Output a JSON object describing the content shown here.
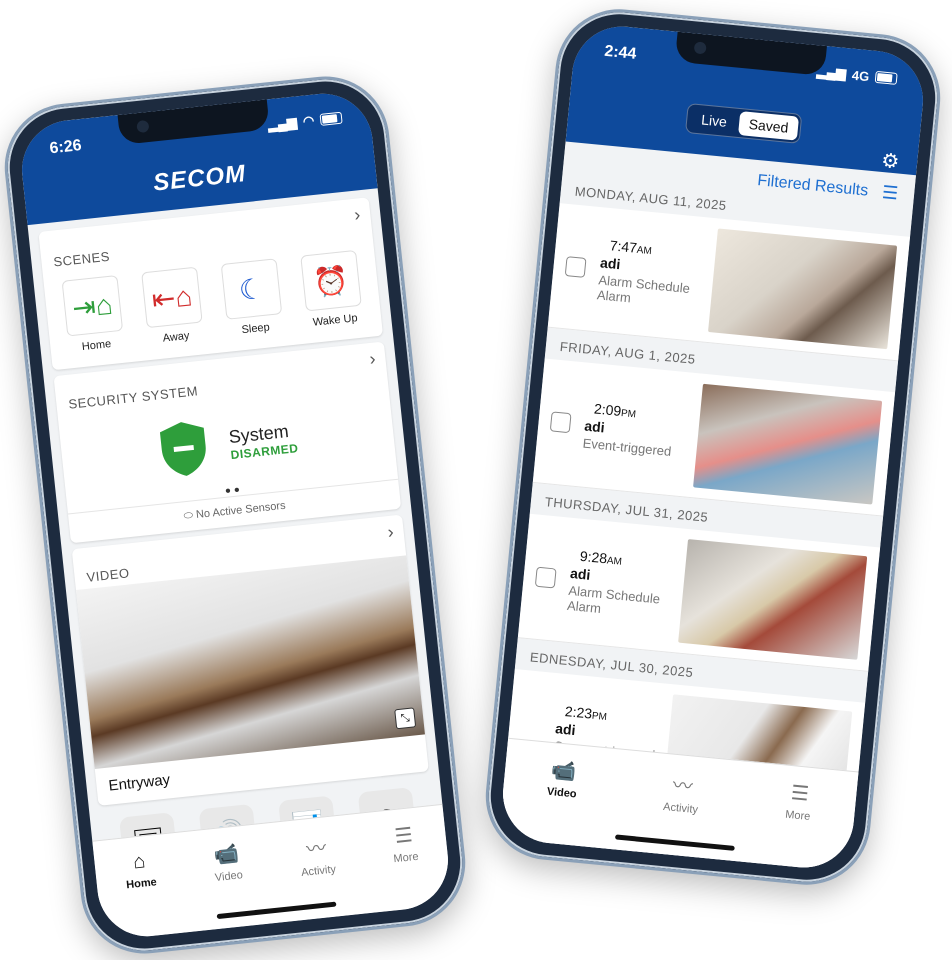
{
  "left": {
    "status_time": "6:26",
    "brand": "SECOM",
    "scenes": {
      "title": "SCENES",
      "items": [
        {
          "label": "Home",
          "icon": "home-arrow-in-icon",
          "color": "#2e9e3b"
        },
        {
          "label": "Away",
          "icon": "home-arrow-out-icon",
          "color": "#d12c2c"
        },
        {
          "label": "Sleep",
          "icon": "moon-icon",
          "color": "#1e5bd1"
        },
        {
          "label": "Wake Up",
          "icon": "alarm-clock-icon",
          "color": "#f0c419"
        }
      ]
    },
    "security": {
      "title": "SECURITY SYSTEM",
      "system_label": "System",
      "state": "DISARMED",
      "state_color": "#2e9e3b",
      "sensors": "No Active Sensors"
    },
    "video": {
      "title": "VIDEO",
      "camera_name": "Entryway"
    },
    "tabs": [
      {
        "label": "Home",
        "icon": "home-icon"
      },
      {
        "label": "Video",
        "icon": "video-camera-icon"
      },
      {
        "label": "Activity",
        "icon": "activity-icon"
      },
      {
        "label": "More",
        "icon": "menu-icon"
      }
    ]
  },
  "right": {
    "status_time": "2:44",
    "network": "4G",
    "segment": {
      "live": "Live",
      "saved": "Saved",
      "selected": "Saved"
    },
    "filtered": "Filtered Results",
    "groups": [
      {
        "date": "MONDAY, AUG 11, 2025",
        "time": "7:47",
        "ampm": "AM",
        "name": "adi",
        "desc": "Alarm Schedule Alarm"
      },
      {
        "date": "FRIDAY, AUG 1, 2025",
        "time": "2:09",
        "ampm": "PM",
        "name": "adi",
        "desc": "Event-triggered"
      },
      {
        "date": "THURSDAY, JUL 31, 2025",
        "time": "9:28",
        "ampm": "AM",
        "name": "adi",
        "desc": "Alarm Schedule Alarm"
      },
      {
        "date": "EDNESDAY, JUL 30, 2025",
        "time": "2:23",
        "ampm": "PM",
        "name": "adi",
        "desc": "Camera-triggered Person)"
      }
    ],
    "partial_time": "PM",
    "tabs": [
      {
        "label": "Video",
        "icon": "video-camera-icon"
      },
      {
        "label": "Activity",
        "icon": "activity-icon"
      },
      {
        "label": "More",
        "icon": "menu-icon"
      }
    ]
  }
}
